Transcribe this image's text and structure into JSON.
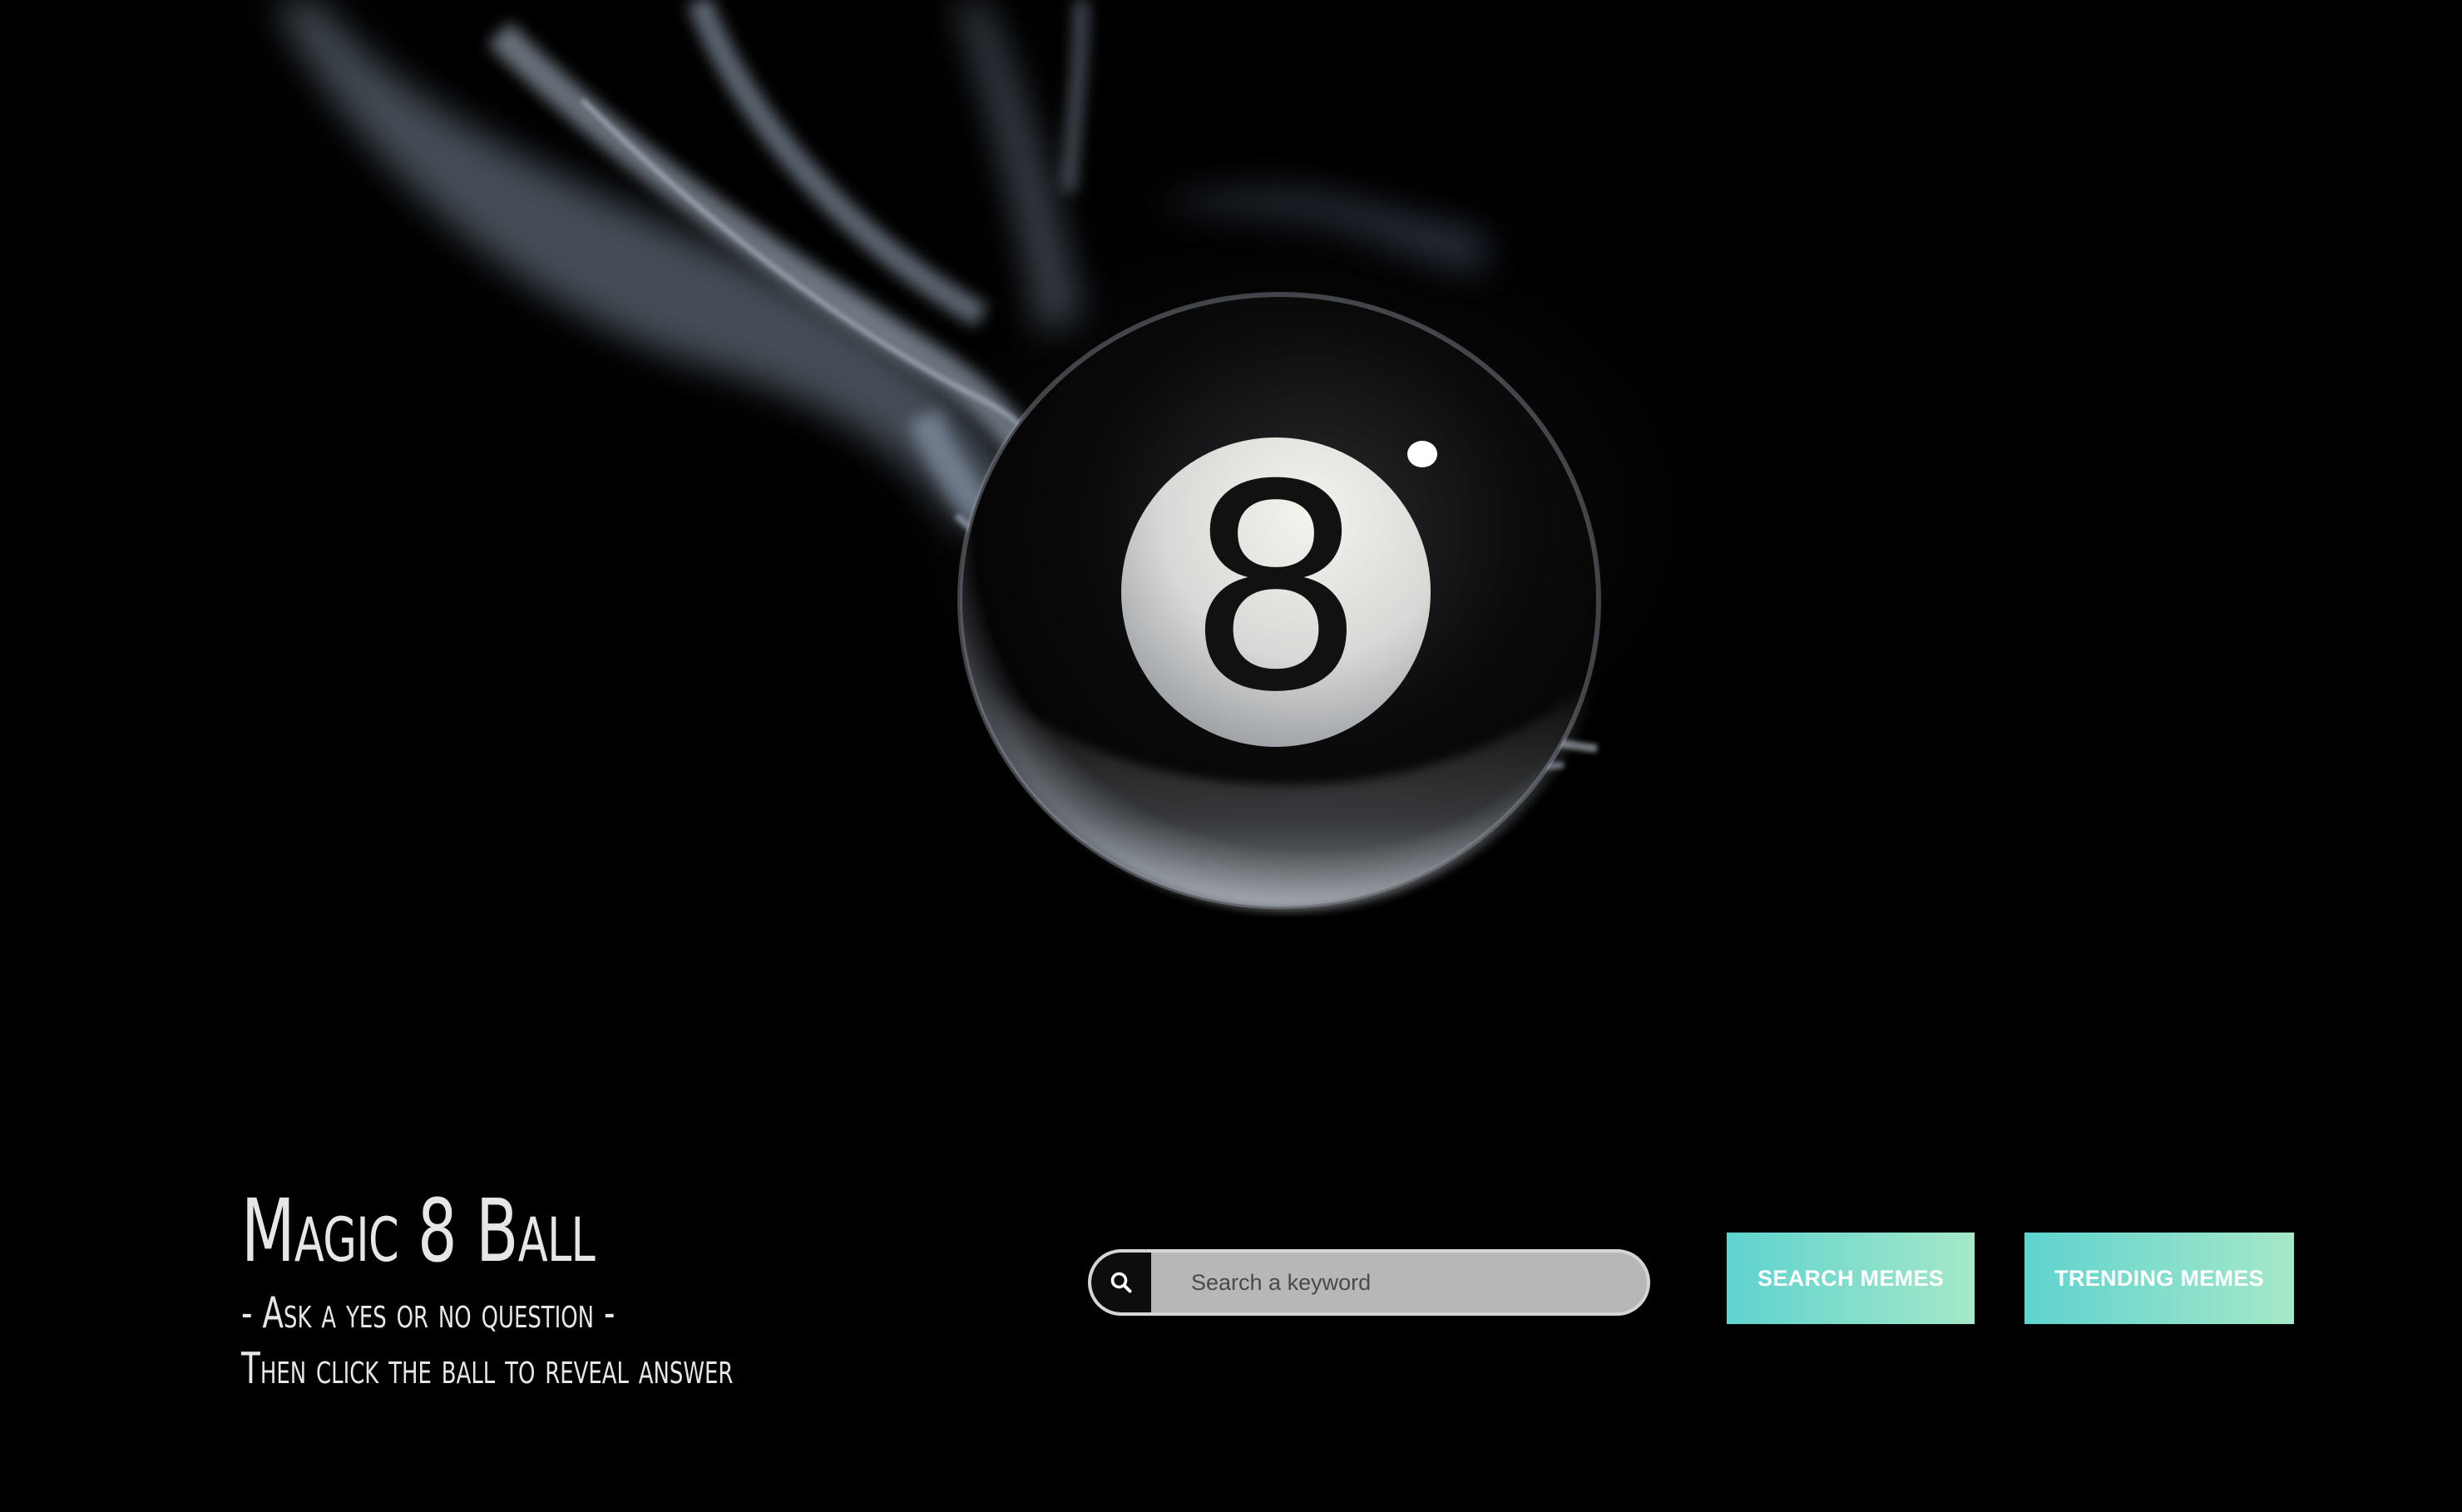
{
  "app": {
    "title": "Magic 8 Ball",
    "subtitle_line1": "- Ask a yes or no question -",
    "subtitle_line2": "Then click the ball to reveal answer"
  },
  "ball": {
    "number": "8"
  },
  "search": {
    "placeholder": "Search a keyword",
    "value": "",
    "icon": "search-icon"
  },
  "buttons": {
    "search_memes": "SEARCH MEMES",
    "trending_memes": "TRENDING MEMES"
  },
  "colors": {
    "background": "#000000",
    "button_gradient_start": "#5fd3cf",
    "button_gradient_end": "#a5e8c8",
    "search_field": "#b7b7b7",
    "text": "#e6e6e6"
  }
}
